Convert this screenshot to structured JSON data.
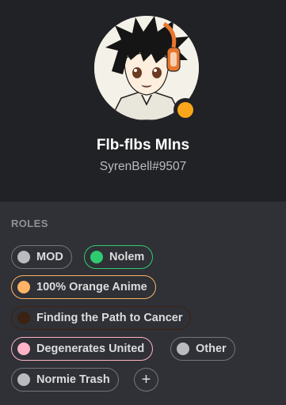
{
  "user": {
    "display_name": "Flb-flbs Mlns",
    "username": "SyrenBell#9507",
    "status": "idle",
    "status_color": "#faa61a"
  },
  "roles": {
    "title": "ROLES",
    "items": [
      {
        "label": "MOD",
        "color": "#b9bbbe",
        "border": "#72767d"
      },
      {
        "label": "Nolem",
        "color": "#2ecc71",
        "border": "#2ecc71"
      },
      {
        "label": "100% Orange Anime",
        "color": "#ffb366",
        "border": "#ffb366"
      },
      {
        "label": "Finding the Path to Cancer",
        "color": "#3b2212",
        "border": "#3b2212"
      },
      {
        "label": "Degenerates United",
        "color": "#ffb3c6",
        "border": "#ffb3c6"
      },
      {
        "label": "Other",
        "color": "#b9bbbe",
        "border": "#72767d"
      },
      {
        "label": "Normie Trash",
        "color": "#b9bbbe",
        "border": "#72767d"
      }
    ],
    "add_label": "+"
  },
  "icons": {
    "avatar": "anime-avatar",
    "status": "idle-status-icon",
    "add": "plus-icon"
  }
}
